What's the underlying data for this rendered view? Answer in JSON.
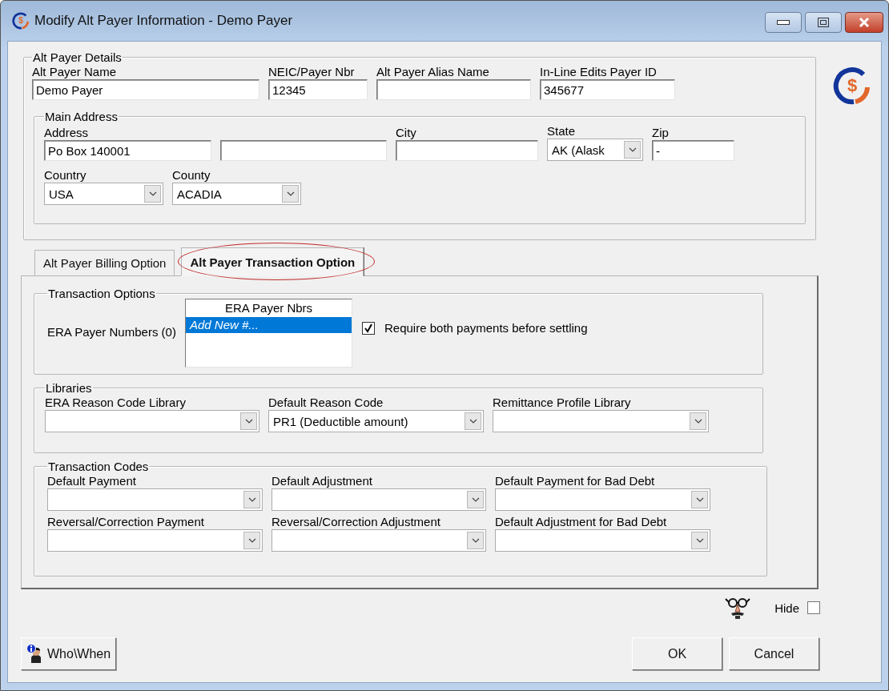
{
  "window": {
    "title": "Modify Alt Payer Information - Demo Payer",
    "icon_symbol": "$"
  },
  "logo": {
    "symbol": "$"
  },
  "details": {
    "legend": "Alt Payer Details",
    "fields": [
      {
        "label": "Alt Payer Name",
        "value": "Demo Payer"
      },
      {
        "label": "NEIC/Payer Nbr",
        "value": "12345"
      },
      {
        "label": "Alt Payer Alias Name"
      },
      {
        "label": "In-Line Edits Payer ID",
        "value": "345677"
      }
    ],
    "main_address": {
      "legend": "Main Address",
      "rows": [
        [
          {
            "kind": "text",
            "label": "Address",
            "value": "Po Box 140001"
          },
          {
            "kind": "text"
          },
          {
            "kind": "text",
            "label": "City"
          },
          {
            "kind": "combo",
            "label": "State",
            "value": "AK  (Alask"
          },
          {
            "kind": "text",
            "label": "Zip",
            "value": "-"
          }
        ],
        [
          {
            "kind": "combo",
            "label": "Country",
            "value": "USA"
          },
          {
            "kind": "combo",
            "label": "County",
            "value": "ACADIA"
          }
        ]
      ]
    }
  },
  "tabs": [
    {
      "label": "Alt Payer Billing Option",
      "selected": false,
      "highlighted": false
    },
    {
      "label": "Alt Payer Transaction Option",
      "selected": true,
      "highlighted": true
    }
  ],
  "transaction_options": {
    "legend": "Transaction Options",
    "label": "ERA Payer Numbers (0)",
    "list": {
      "header": "ERA Payer Nbrs",
      "items": [
        {
          "text": "Add New #...",
          "selected": true
        }
      ]
    },
    "checkbox": {
      "label": "Require both payments before settling",
      "checked": true
    }
  },
  "libraries": {
    "legend": "Libraries",
    "fields": [
      {
        "label": "ERA Reason Code Library"
      },
      {
        "label": "Default Reason Code",
        "value": "PR1 (Deductible amount)"
      },
      {
        "label": "Remittance Profile Library"
      }
    ]
  },
  "transaction_codes": {
    "legend": "Transaction Codes",
    "rows": [
      [
        {
          "label": "Default Payment"
        },
        {
          "label": "Default Adjustment"
        },
        {
          "label": "Default Payment for Bad Debt"
        }
      ],
      [
        {
          "label": "Reversal/Correction Payment"
        },
        {
          "label": "Reversal/Correction Adjustment"
        },
        {
          "label": "Default Adjustment for Bad Debt"
        }
      ]
    ]
  },
  "hide": {
    "label": "Hide",
    "checked": false
  },
  "buttons": {
    "who_when": "Who\\When",
    "ok": "OK",
    "cancel": "Cancel"
  }
}
